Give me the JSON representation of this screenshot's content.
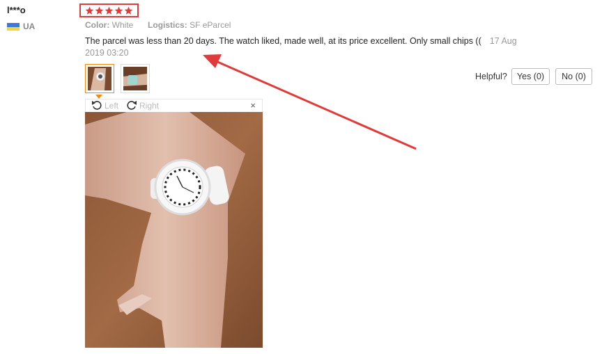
{
  "reviewer": {
    "name": "l***o",
    "country": "UA"
  },
  "rating": {
    "value": 5,
    "max": 5,
    "color": "#e03a3a"
  },
  "attributes": {
    "color_label": "Color:",
    "color_value": "White",
    "logistics_label": "Logistics:",
    "logistics_value": "SF eParcel"
  },
  "review": {
    "text": "The parcel was less than 20 days. The watch liked, made well, at its price excellent. Only small chips ((",
    "date": "17 Aug 2019 03:20"
  },
  "thumbnails": [
    {
      "icon": "watch-on-wrist-photo",
      "selected": true
    },
    {
      "icon": "watch-on-wrist-photo",
      "selected": false
    }
  ],
  "viewer": {
    "rotate_left_label": "Left",
    "rotate_right_label": "Right",
    "close_label": "×"
  },
  "helpful": {
    "label": "Helpful?",
    "yes_label": "Yes (0)",
    "no_label": "No (0)"
  },
  "annotation": {
    "arrow_color": "#e03a3a"
  }
}
